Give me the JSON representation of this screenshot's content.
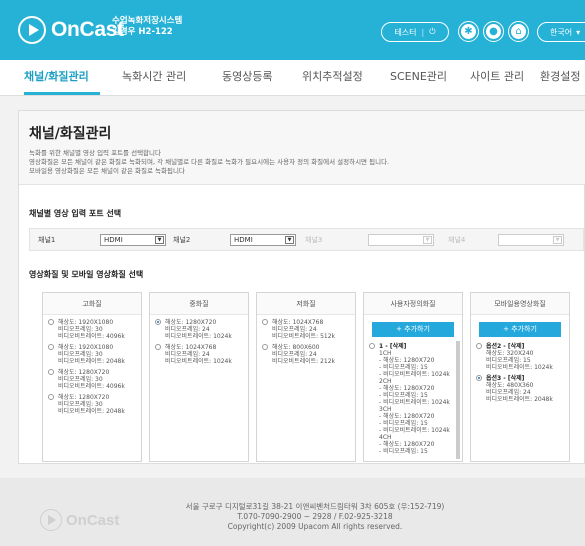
{
  "brand": {
    "logo": "OnCast",
    "system_name_1": "수업녹화저장시스템",
    "system_name_2": "김경우 H2-122"
  },
  "topbar": {
    "test_label": "테스터",
    "power_icon": "⏻",
    "language": "한국어",
    "accent": "#25b2d6"
  },
  "nav": {
    "tabs": [
      "채널/화질관리",
      "녹화시간 관리",
      "동영상등록",
      "위치추적설정",
      "SCENE관리",
      "사이트 관리",
      "환경설정"
    ]
  },
  "page": {
    "title": "채널/화질관리",
    "desc": [
      "녹화를 위한 채널별 영상 입력 포트를 선택합니다",
      "영상화질은 모든 채널이 같은 화질로 녹화되며, 각 채널별로 다른 화질로 녹화가 필요시에는 사용자 정의 화질에서 설정하시면 됩니다.",
      "모바일용 영상화질은 모든 채널이 같은 화질로 녹화됩니다"
    ]
  },
  "channels": {
    "section_title": "채널별 영상 입력 포트 선택",
    "items": [
      {
        "label": "채널1",
        "value": "HDMI"
      },
      {
        "label": "채널2",
        "value": "HDMI"
      },
      {
        "label": "채널3",
        "value": ""
      },
      {
        "label": "채널4",
        "value": ""
      }
    ]
  },
  "quality": {
    "section_title": "영상화질 및 모바일 영상화질 선택",
    "add_label": "+ 추가하기",
    "columns": [
      {
        "title": "고화질",
        "options": [
          [
            "해상도: 1920X1080",
            "비디오프레임: 30",
            "비디오비트레이트: 4096k"
          ],
          [
            "해상도: 1920X1080",
            "비디오프레임: 30",
            "비디오비트레이트: 2048k"
          ],
          [
            "해상도: 1280X720",
            "비디오프레임: 30",
            "비디오비트레이트: 4096k"
          ],
          [
            "해상도: 1280X720",
            "비디오프레임: 30",
            "비디오비트레이트: 2048k"
          ]
        ]
      },
      {
        "title": "중화질",
        "options": [
          [
            "해상도: 1280X720",
            "비디오프레임: 24",
            "비디오비트레이트: 1024k"
          ],
          [
            "해상도: 1024X768",
            "비디오프레임: 24",
            "비디오비트레이트: 1024k"
          ]
        ]
      },
      {
        "title": "저화질",
        "options": [
          [
            "해상도: 1024X768",
            "비디오프레임: 24",
            "비디오비트레이트: 512k"
          ],
          [
            "해상도: 800X600",
            "비디오프레임: 24",
            "비디오비트레이트: 212k"
          ]
        ]
      },
      {
        "title": "사용자정의화질",
        "custom": {
          "name": "1 - [삭제]",
          "lines": [
            "1CH",
            "- 해상도: 1280X720",
            "- 비디오프레임: 15",
            "- 비디오비트레이트: 1024k",
            "2CH",
            "- 해상도: 1280X720",
            "- 비디오프레임: 15",
            "- 비디오비트레이트: 1024k",
            "3CH",
            "- 해상도: 1280X720",
            "- 비디오프레임: 15",
            "- 비디오비트레이트: 1024k",
            "4CH",
            "- 해상도: 1280X720",
            "- 비디오프레임: 15"
          ]
        }
      },
      {
        "title": "모바일용영상화질",
        "mobile": [
          {
            "name": "옵션2 - [삭제]",
            "lines": [
              "해상도: 320X240",
              "비디오프레임: 15",
              "비디오비트레이트: 1024k"
            ]
          },
          {
            "name": "옵션3 - [삭제]",
            "lines": [
              "해상도: 480X360",
              "비디오프레임: 24",
              "비디오비트레이트: 2048k"
            ]
          }
        ]
      }
    ]
  },
  "footer": {
    "logo": "OnCast",
    "address": "서울 구로구 디지털로31길 38-21 이앤씨벤처드림타워 3차 605호 (우:152-719)",
    "phone": "T.070-7090-2900 ~ 2928 / F.02-925-3218",
    "copyright": "Copyright(c) 2009 Upacom All rights reserved."
  }
}
